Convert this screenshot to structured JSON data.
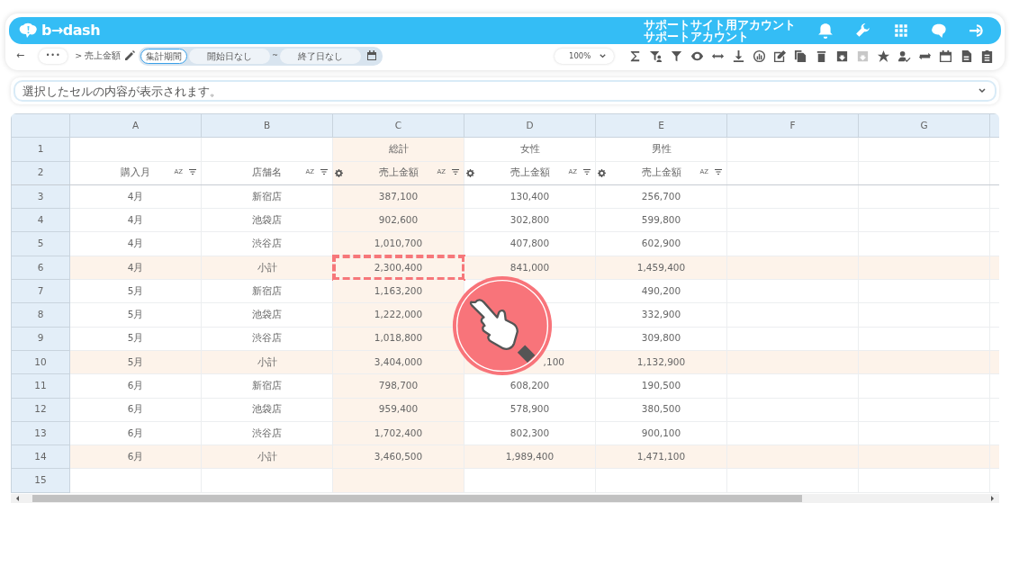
{
  "header": {
    "logo": "b→dash",
    "account_lines": [
      "サポートサイト用アカウント",
      "サポートアカウント"
    ],
    "icons": [
      {
        "kind": "bell"
      },
      {
        "kind": "wrench"
      },
      {
        "kind": "apps"
      },
      {
        "kind": "chat"
      },
      {
        "kind": "signin"
      }
    ]
  },
  "toolbar": {
    "back": "←",
    "more": "•••",
    "breadcrumb": "> 売上金額",
    "period_label": "集計期間",
    "start": "開始日なし",
    "tilde": "~",
    "end": "終了日なし",
    "zoom": "100%",
    "tools": [
      {
        "kind": "sigma",
        "disabled": false
      },
      {
        "kind": "filter-user",
        "disabled": false
      },
      {
        "kind": "filter",
        "disabled": false
      },
      {
        "kind": "eye",
        "disabled": false
      },
      {
        "kind": "code",
        "disabled": false
      },
      {
        "kind": "download",
        "disabled": false
      },
      {
        "kind": "chart",
        "disabled": false
      },
      {
        "kind": "edit",
        "disabled": false
      },
      {
        "kind": "copy",
        "disabled": false
      },
      {
        "kind": "trash",
        "disabled": false
      },
      {
        "kind": "archive",
        "disabled": false
      },
      {
        "kind": "archive",
        "disabled": true
      },
      {
        "kind": "star",
        "disabled": false
      },
      {
        "kind": "user-check",
        "disabled": false
      },
      {
        "kind": "repeat",
        "disabled": false
      },
      {
        "kind": "calendar",
        "disabled": false
      },
      {
        "kind": "file",
        "disabled": false
      },
      {
        "kind": "clipboard",
        "disabled": false
      }
    ]
  },
  "formula_bar": {
    "placeholder": "選択したセルの内容が表示されます。"
  },
  "grid": {
    "columns": [
      {
        "letter": "A",
        "highlight": false
      },
      {
        "letter": "B",
        "highlight": false
      },
      {
        "letter": "C",
        "highlight": true
      },
      {
        "letter": "D",
        "highlight": false
      },
      {
        "letter": "E",
        "highlight": false
      },
      {
        "letter": "F",
        "highlight": false
      },
      {
        "letter": "G",
        "highlight": false
      }
    ],
    "rows": [
      {
        "number": "1",
        "kind": "data",
        "cells": [
          null,
          null,
          "総計",
          "女性",
          "男性",
          null,
          null
        ]
      },
      {
        "number": "2",
        "kind": "field",
        "cells": [
          {
            "text": "購入月",
            "gear": false,
            "sort_label": "AZ"
          },
          {
            "text": "店舗名",
            "gear": false,
            "sort_label": "AZ"
          },
          {
            "text": "売上金額",
            "gear": true,
            "sort_label": "AZ"
          },
          {
            "text": "売上金額",
            "gear": true,
            "sort_label": "AZ"
          },
          {
            "text": "売上金額",
            "gear": true,
            "sort_label": "AZ"
          },
          null,
          null
        ]
      },
      {
        "number": "3",
        "kind": "data",
        "cells": [
          "4月",
          "新宿店",
          "387,100",
          "130,400",
          "256,700",
          null,
          null
        ]
      },
      {
        "number": "4",
        "kind": "data",
        "cells": [
          "4月",
          "池袋店",
          "902,600",
          "302,800",
          "599,800",
          null,
          null
        ]
      },
      {
        "number": "5",
        "kind": "data",
        "cells": [
          "4月",
          "渋谷店",
          "1,010,700",
          "407,800",
          "602,900",
          null,
          null
        ]
      },
      {
        "number": "6",
        "kind": "subtotal",
        "cells": [
          "4月",
          "小計",
          {
            "text": "2,300,400",
            "marked": true
          },
          "841,000",
          "1,459,400",
          null,
          null
        ]
      },
      {
        "number": "7",
        "kind": "data",
        "cells": [
          "5月",
          "新宿店",
          "1,163,200",
          null,
          "490,200",
          null,
          null
        ]
      },
      {
        "number": "8",
        "kind": "data",
        "cells": [
          "5月",
          "池袋店",
          "1,222,000",
          null,
          "332,900",
          null,
          null
        ]
      },
      {
        "number": "9",
        "kind": "data",
        "cells": [
          "5月",
          "渋谷店",
          "1,018,800",
          null,
          "309,800",
          null,
          null
        ]
      },
      {
        "number": "10",
        "kind": "subtotal",
        "cells": [
          "5月",
          "小計",
          "3,404,000",
          {
            "text": ",100",
            "cut": true
          },
          "1,132,900",
          null,
          null
        ]
      },
      {
        "number": "11",
        "kind": "data",
        "cells": [
          "6月",
          "新宿店",
          "798,700",
          "608,200",
          "190,500",
          null,
          null
        ]
      },
      {
        "number": "12",
        "kind": "data",
        "cells": [
          "6月",
          "池袋店",
          "959,400",
          "578,900",
          "380,500",
          null,
          null
        ]
      },
      {
        "number": "13",
        "kind": "data",
        "cells": [
          "6月",
          "渋谷店",
          "1,702,400",
          "802,300",
          "900,100",
          null,
          null
        ]
      },
      {
        "number": "14",
        "kind": "subtotal",
        "cells": [
          "6月",
          "小計",
          "3,460,500",
          "1,989,400",
          "1,471,100",
          null,
          null
        ]
      },
      {
        "number": "15",
        "kind": "data",
        "cells": [
          null,
          null,
          null,
          null,
          null,
          null,
          null
        ]
      }
    ]
  }
}
